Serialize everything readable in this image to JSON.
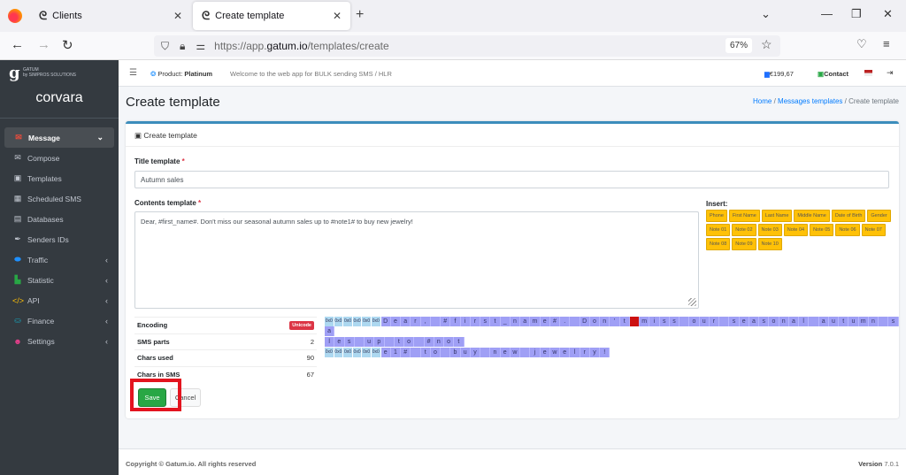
{
  "browser": {
    "tabs": [
      {
        "label": "Clients",
        "active": false
      },
      {
        "label": "Create template",
        "active": true
      }
    ],
    "url_prefix": "https://app.",
    "url_domain": "gatum.io",
    "url_path": "/templates/create",
    "zoom": "67%"
  },
  "sidebar": {
    "brand_small": "GATUM",
    "brand_sub": "by SIMPROS SOLUTIONS",
    "company": "corvara",
    "items": [
      {
        "label": "Message",
        "icon": "message-icon",
        "color": "#e74c3c",
        "expanded": true
      },
      {
        "label": "Compose",
        "icon": "envelope-icon",
        "color": "#c2c7d0"
      },
      {
        "label": "Templates",
        "icon": "inbox-icon",
        "color": "#c2c7d0"
      },
      {
        "label": "Scheduled SMS",
        "icon": "calendar-icon",
        "color": "#c2c7d0"
      },
      {
        "label": "Databases",
        "icon": "clipboard-icon",
        "color": "#c2c7d0"
      },
      {
        "label": "Senders IDs",
        "icon": "feather-icon",
        "color": "#c2c7d0"
      },
      {
        "label": "Traffic",
        "icon": "traffic-icon",
        "color": "#1e90ff"
      },
      {
        "label": "Statistic",
        "icon": "chart-icon",
        "color": "#28a745"
      },
      {
        "label": "API",
        "icon": "code-icon",
        "color": "#ffc107"
      },
      {
        "label": "Finance",
        "icon": "finance-icon",
        "color": "#17a2b8"
      },
      {
        "label": "Settings",
        "icon": "user-cog-icon",
        "color": "#e83e8c"
      }
    ]
  },
  "header": {
    "product_label": "Product:",
    "product_value": "Platinum",
    "welcome": "Welcome to the web app for BULK sending SMS / HLR",
    "balance": "€199,67",
    "contact": "Contact"
  },
  "page": {
    "title": "Create template",
    "breadcrumb": {
      "home": "Home",
      "section": "Messages templates",
      "current": "Create template"
    }
  },
  "form": {
    "card_title": "Create template",
    "title_label": "Title template",
    "title_value": "Autumn sales",
    "contents_label": "Contents template",
    "contents_value": "Dear, #first_name#. Don't miss our seasonal autumn sales up to #note1# to buy new jewelry!",
    "insert_label": "Insert:",
    "insert_chips": [
      "Phone",
      "First Name",
      "Last Name",
      "Middle Name",
      "Date of Birth",
      "Gender",
      "Note 01",
      "Note 02",
      "Note 03",
      "Note 04",
      "Note 05",
      "Note 06",
      "Note 07",
      "Note 08",
      "Note 09",
      "Note 10"
    ],
    "stats": [
      {
        "key": "Encoding",
        "value": "Unicode",
        "badge": true
      },
      {
        "key": "SMS parts",
        "value": "2"
      },
      {
        "key": "Chars used",
        "value": "90"
      },
      {
        "key": "Chars in SMS",
        "value": "67"
      }
    ],
    "encoding_rows": [
      {
        "header": true,
        "chars": "Dear, #first_name#. Don't miss our seasonal autumn sa",
        "bad_index": 25
      },
      {
        "header": false,
        "chars": "les up to #not",
        "bad_index": -1
      },
      {
        "header": true,
        "chars": "e1# to buy new jewelry!",
        "bad_index": -1
      }
    ],
    "hex_label": "0x0",
    "save": "Save",
    "cancel": "Cancel"
  },
  "footer": {
    "copyright": "Copyright © Gatum.io. All rights reserved",
    "version_label": "Version",
    "version": "7.0.1"
  }
}
